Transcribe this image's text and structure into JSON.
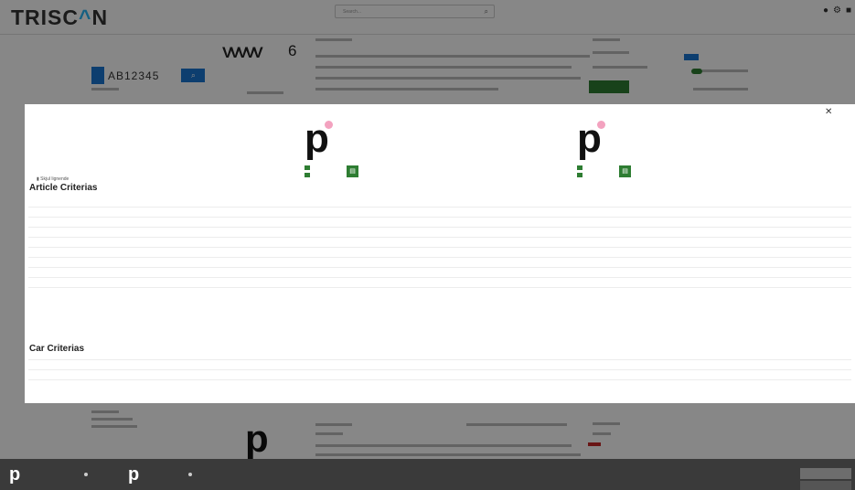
{
  "app": {
    "logo_prefix": "TRISC",
    "logo_accent": "^",
    "logo_suffix": "N"
  },
  "topbar": {
    "search_placeholder": "Search...",
    "account_lines": [
      "",
      "",
      ""
    ]
  },
  "vehicle": {
    "vin": "AB12345",
    "search_label": ""
  },
  "background_product": {
    "belt_count": "6"
  },
  "modal": {
    "hide_similar_label": "Skjul lignende",
    "products": [
      {
        "in_stock": "",
        "delivery": "",
        "cart_icon": "cart-icon"
      },
      {
        "in_stock": "",
        "delivery": "",
        "cart_icon": "cart-icon"
      }
    ],
    "article_criteria": {
      "title": "Article Criterias",
      "rows": [
        {
          "label": "",
          "a": "",
          "b": ""
        },
        {
          "label": "",
          "a": "",
          "b": ""
        },
        {
          "label": "",
          "a": "",
          "b": ""
        },
        {
          "label": "",
          "a": "",
          "b": ""
        },
        {
          "label": "",
          "a": "",
          "b": ""
        },
        {
          "label": "",
          "a": "",
          "b": ""
        },
        {
          "label": "",
          "a": "",
          "b": ""
        },
        {
          "label": "",
          "a": "",
          "b": ""
        },
        {
          "label": "",
          "a": "",
          "b": ""
        }
      ]
    },
    "car_criteria": {
      "title": "Car Criterias",
      "rows": [
        {
          "label": "",
          "a": "",
          "b": ""
        },
        {
          "label": "",
          "a": "",
          "b": ""
        },
        {
          "label": "",
          "a": "",
          "b": ""
        }
      ]
    }
  },
  "dock": {
    "items": [
      "",
      ""
    ],
    "buttons": [
      "",
      ""
    ]
  },
  "colors": {
    "accent_blue": "#1976d2",
    "stock_green": "#2e7d32",
    "logo_accent": "#29b6f6",
    "product_dot": "#f3a2bf"
  }
}
